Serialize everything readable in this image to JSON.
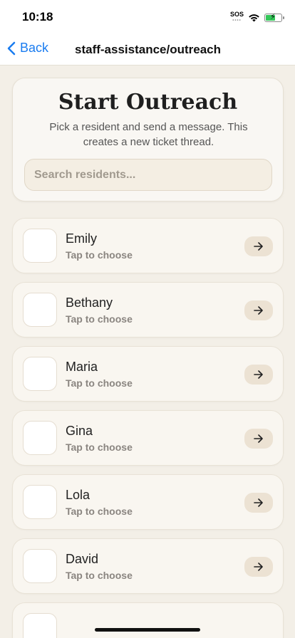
{
  "status_bar": {
    "time": "10:18",
    "sos": "SOS",
    "icons": [
      "sos-icon",
      "wifi-icon",
      "battery-charging-icon"
    ],
    "battery_color": "#34c759"
  },
  "nav": {
    "back_label": "Back",
    "title": "staff-assistance/outreach",
    "accent": "#1a7cf0"
  },
  "header": {
    "title": "Start Outreach",
    "subtitle": "Pick a resident and send a message. This creates a new ticket thread."
  },
  "search": {
    "placeholder": "Search residents..."
  },
  "residents": [
    {
      "name": "Emily",
      "hint": "Tap to choose"
    },
    {
      "name": "Bethany",
      "hint": "Tap to choose"
    },
    {
      "name": "Maria",
      "hint": "Tap to choose"
    },
    {
      "name": "Gina",
      "hint": "Tap to choose"
    },
    {
      "name": "Lola",
      "hint": "Tap to choose"
    },
    {
      "name": "David",
      "hint": "Tap to choose"
    }
  ],
  "row_action_icon": "arrow-right-icon"
}
